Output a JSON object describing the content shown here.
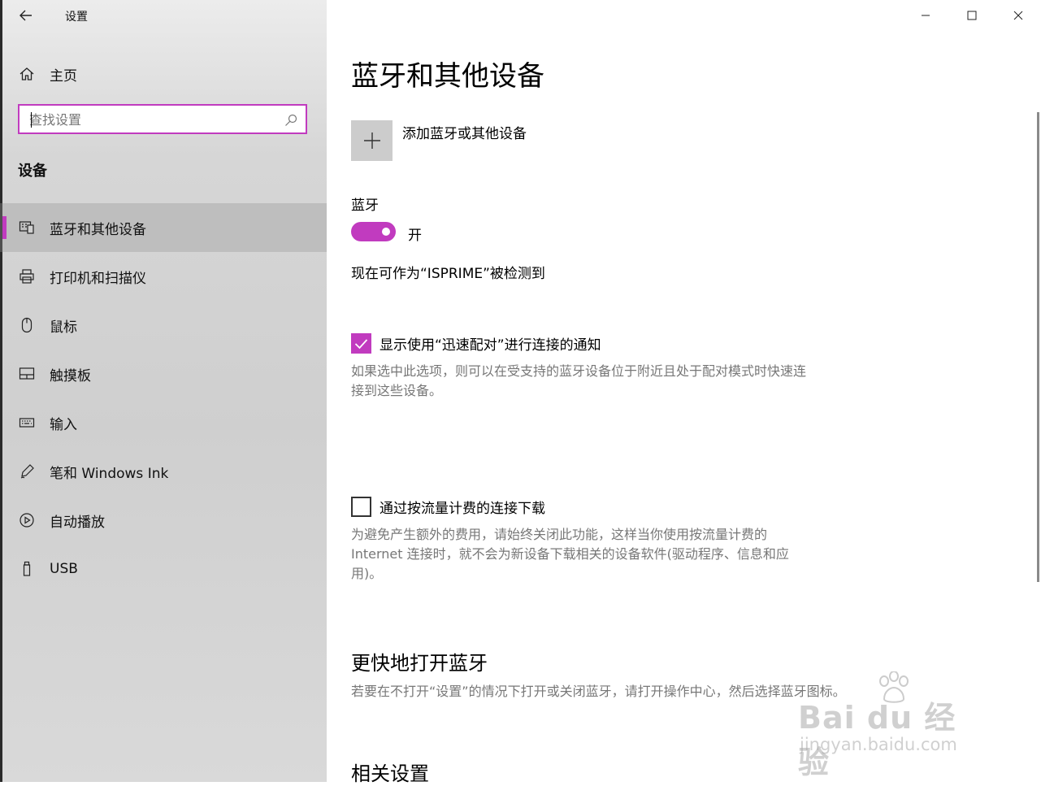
{
  "window": {
    "title": "设置",
    "controls": [
      "minimize-icon",
      "maximize-icon",
      "close-icon"
    ]
  },
  "sidebar": {
    "home_label": "主页",
    "search_placeholder": "查找设置",
    "section": "设备",
    "items": [
      {
        "label": "蓝牙和其他设备",
        "icon": "bluetooth-devices-icon",
        "selected": true
      },
      {
        "label": "打印机和扫描仪",
        "icon": "printer-icon",
        "selected": false
      },
      {
        "label": "鼠标",
        "icon": "mouse-icon",
        "selected": false
      },
      {
        "label": "触摸板",
        "icon": "touchpad-icon",
        "selected": false
      },
      {
        "label": "输入",
        "icon": "keyboard-icon",
        "selected": false
      },
      {
        "label": "笔和 Windows Ink",
        "icon": "pen-icon",
        "selected": false
      },
      {
        "label": "自动播放",
        "icon": "autoplay-icon",
        "selected": false
      },
      {
        "label": "USB",
        "icon": "usb-icon",
        "selected": false
      }
    ]
  },
  "main": {
    "title": "蓝牙和其他设备",
    "add_device_label": "添加蓝牙或其他设备",
    "bluetooth_label": "蓝牙",
    "bluetooth_state": "开",
    "discoverable_text": "现在可作为“ISPRIME”被检测到",
    "swift_pair": {
      "label": "显示使用“迅速配对”进行连接的通知",
      "checked": true,
      "description": "如果选中此选项，则可以在受支持的蓝牙设备位于附近且处于配对模式时快速连接到这些设备。"
    },
    "metered": {
      "label": "通过按流量计费的连接下载",
      "checked": false,
      "description": "为避免产生额外的费用，请始终关闭此功能，这样当你使用按流量计费的 Internet 连接时，就不会为新设备下载相关的设备软件(驱动程序、信息和应用)。"
    },
    "quick_heading": "更快地打开蓝牙",
    "quick_description": "若要在不打开“设置”的情况下打开或关闭蓝牙，请打开操作中心，然后选择蓝牙图标。",
    "related_heading": "相关设置"
  },
  "watermark": {
    "main": "Bai du 经验",
    "sub": "jingyan.baidu.com"
  },
  "colors": {
    "accent": "#c13bbf",
    "sidebar_bg": "#d4d4d4",
    "description_text": "#777777"
  }
}
